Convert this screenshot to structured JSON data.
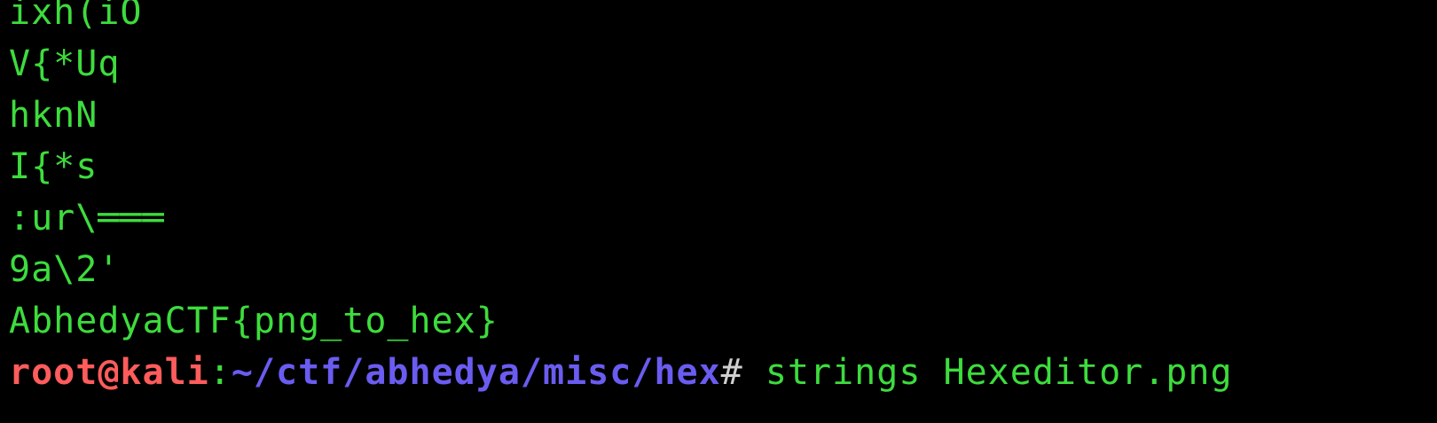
{
  "terminal": {
    "output_lines": [
      "ixh(iO",
      "V{*Uq",
      "hknN",
      "I{*s",
      ":ur\\═══",
      "9a\\2'",
      "AbhedyaCTF{png_to_hex}"
    ],
    "prompt": {
      "user_host": "root@kali",
      "separator": ":",
      "path": "~/ctf/abhedya/misc/hex",
      "symbol": "#",
      "command": " strings Hexeditor.png"
    }
  },
  "colors": {
    "background": "#000000",
    "output_text": "#3ddc3d",
    "prompt_user": "#ff5c5c",
    "prompt_path": "#6a5cf0"
  }
}
